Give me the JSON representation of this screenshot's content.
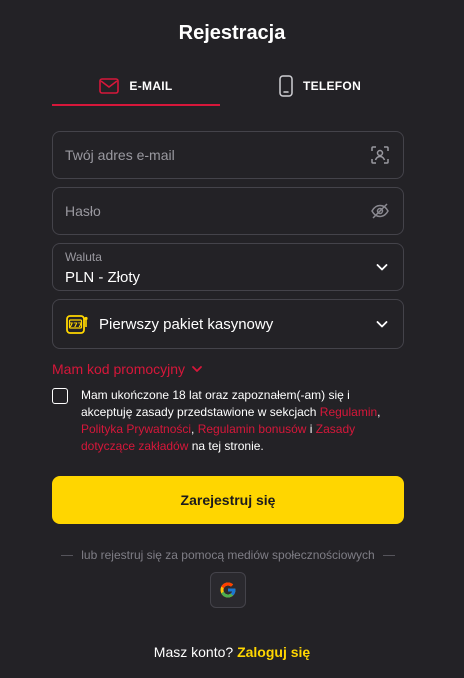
{
  "title": "Rejestracja",
  "tabs": {
    "email_label": "E-MAIL",
    "phone_label": "TELEFON",
    "active": "email"
  },
  "form": {
    "email_placeholder": "Twój adres e-mail",
    "password_placeholder": "Hasło",
    "currency_label": "Waluta",
    "currency_value": "PLN - Złoty",
    "package_value": "Pierwszy pakiet kasynowy",
    "promo_label": "Mam kod promocyjny",
    "terms_text_1": "Mam ukończone 18 lat oraz zapoznałem(-am) się i akceptuję zasady przedstawione w sekcjach ",
    "terms_link_1": "Regulamin",
    "terms_sep_1": ", ",
    "terms_link_2": "Polityka Prywatności",
    "terms_sep_2": ", ",
    "terms_link_3": "Regulamin bonusów",
    "terms_sep_3": " i ",
    "terms_link_4": "Zasady dotyczące zakładów",
    "terms_text_2": " na tej stronie.",
    "submit_label": "Zarejestruj się"
  },
  "social": {
    "divider_text": "lub rejestruj się za pomocą mediów społecznościowych"
  },
  "footer": {
    "question": "Masz konto?",
    "login_link": "Zaloguj się"
  },
  "colors": {
    "background": "#232226",
    "accent_red": "#d6173a",
    "accent_yellow": "#ffd600"
  },
  "icons": {
    "email_tab": "envelope-icon",
    "phone_tab": "phone-icon",
    "email_field": "face-scan-icon",
    "password_field": "eye-off-icon",
    "currency": "chevron-down-icon",
    "package": "slot-machine-icon",
    "social": "google-icon"
  }
}
